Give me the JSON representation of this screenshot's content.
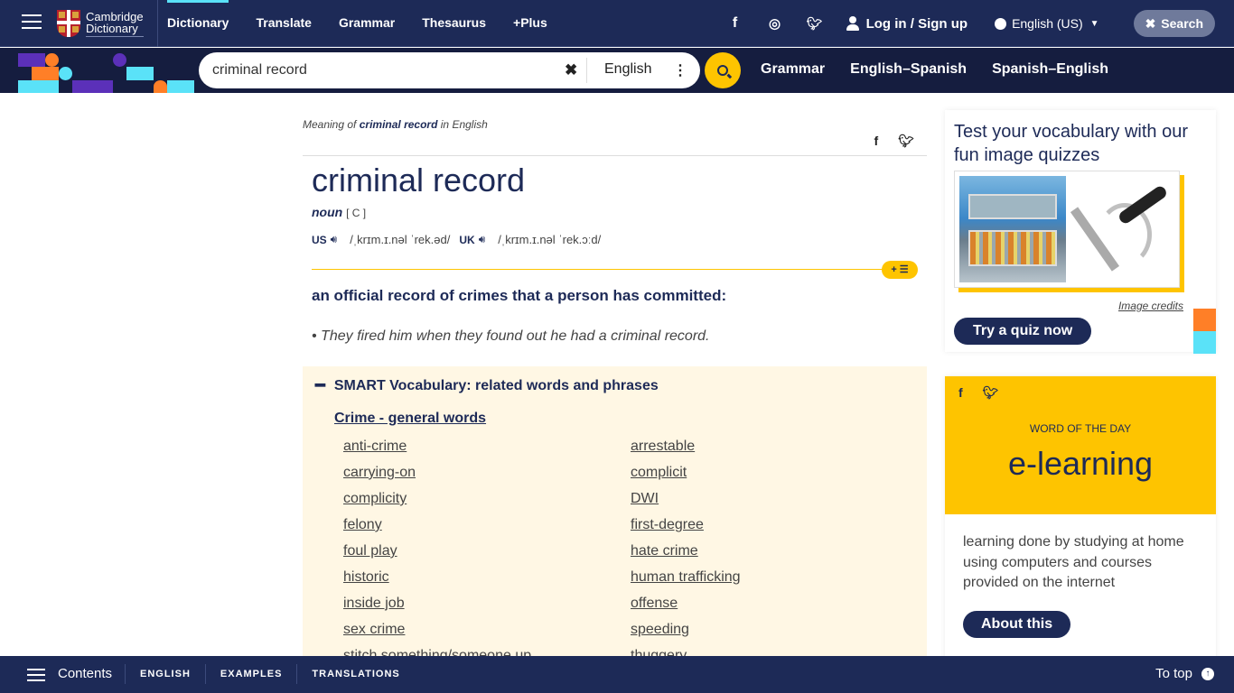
{
  "header": {
    "logo_line1": "Cambridge",
    "logo_line2": "Dictionary",
    "nav": [
      "Dictionary",
      "Translate",
      "Grammar",
      "Thesaurus",
      "+Plus"
    ],
    "social_icons": [
      "facebook-icon",
      "instagram-icon",
      "twitter-icon"
    ],
    "login_label": "Log in / Sign up",
    "language_label": "English (US)",
    "search_toggle_label": "Search"
  },
  "search": {
    "query": "criminal record",
    "dictionary_select": "English",
    "sub_nav": [
      "Grammar",
      "English–Spanish",
      "Spanish–English"
    ]
  },
  "entry": {
    "meaning_prefix": "Meaning of",
    "meaning_word": "criminal record",
    "meaning_suffix": "in English",
    "headword": "criminal record",
    "pos": "noun",
    "grammar": "[ C ]",
    "pron_us_label": "us",
    "pron_us_ipa": "/ˌkrɪm.ɪ.nəl ˈrek.əd/",
    "pron_uk_label": "uk",
    "pron_uk_ipa": "/ˌkrɪm.ɪ.nəl ˈrek.ɔːd/",
    "add_to_list_label": "+ ☰",
    "definition": "an official record of crimes that a person has committed:",
    "example": "They fired him when they found out he had a criminal record."
  },
  "smart_vocab": {
    "heading": "SMART Vocabulary: related words and phrases",
    "topic": "Crime - general words",
    "words": [
      "anti-crime",
      "arrestable",
      "carrying-on",
      "complicit",
      "complicity",
      "DWI",
      "felony",
      "first-degree",
      "foul play",
      "hate crime",
      "historic",
      "human trafficking",
      "inside job",
      "offense",
      "sex crime",
      "speeding",
      "stitch something/someone up",
      "thuggery"
    ]
  },
  "quiz": {
    "title": "Test your vocabulary with our fun image quizzes",
    "image_credits": "Image credits",
    "button": "Try a quiz now"
  },
  "wotd": {
    "label": "WORD OF THE DAY",
    "word": "e-learning",
    "definition": "learning done by studying at home using computers and courses provided on the internet",
    "button": "About this"
  },
  "bottom_bar": {
    "contents_label": "Contents",
    "tabs": [
      "ENGLISH",
      "EXAMPLES",
      "TRANSLATIONS"
    ],
    "to_top_label": "To top"
  },
  "colors": {
    "brand_navy": "#1d2a57",
    "accent_yellow": "#fec400",
    "accent_cyan": "#5ae2f8",
    "accent_orange": "#ff7f27",
    "accent_purple": "#5b30b9",
    "smart_bg": "#fff7e4"
  }
}
